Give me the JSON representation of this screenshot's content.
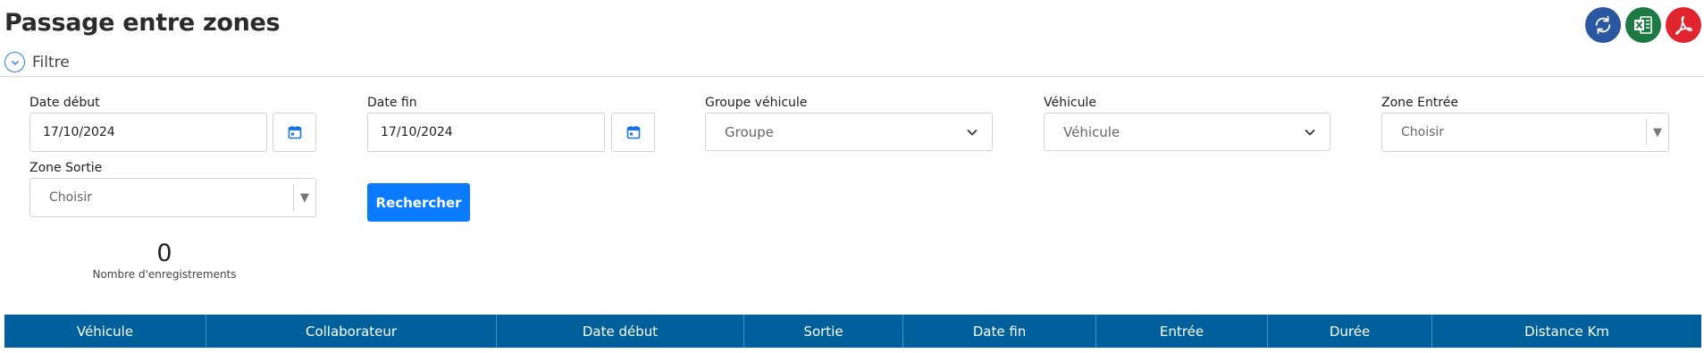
{
  "page": {
    "title": "Passage entre zones"
  },
  "actions": {
    "refresh": "refresh-icon",
    "excel": "excel-icon",
    "pdf": "pdf-icon"
  },
  "filter": {
    "label": "Filtre",
    "date_debut": {
      "label": "Date début",
      "value": "17/10/2024"
    },
    "date_fin": {
      "label": "Date fin",
      "value": "17/10/2024"
    },
    "groupe_vehicule": {
      "label": "Groupe véhicule",
      "selected": "Groupe"
    },
    "vehicule": {
      "label": "Véhicule",
      "selected": "Véhicule"
    },
    "zone_entree": {
      "label": "Zone Entrée",
      "selected": "Choisir"
    },
    "zone_sortie": {
      "label": "Zone Sortie",
      "selected": "Choisir"
    },
    "search_label": "Rechercher"
  },
  "summary": {
    "count": "0",
    "label": "Nombre d'enregistrements"
  },
  "table": {
    "columns": [
      "Véhicule",
      "Collaborateur",
      "Date début",
      "Sortie",
      "Date fin",
      "Entrée",
      "Durée",
      "Distance Km"
    ]
  },
  "colors": {
    "primary": "#0a7bff",
    "header": "#00609c",
    "refresh": "#2b56a0",
    "excel": "#1e7a45",
    "pdf": "#e0252f"
  }
}
